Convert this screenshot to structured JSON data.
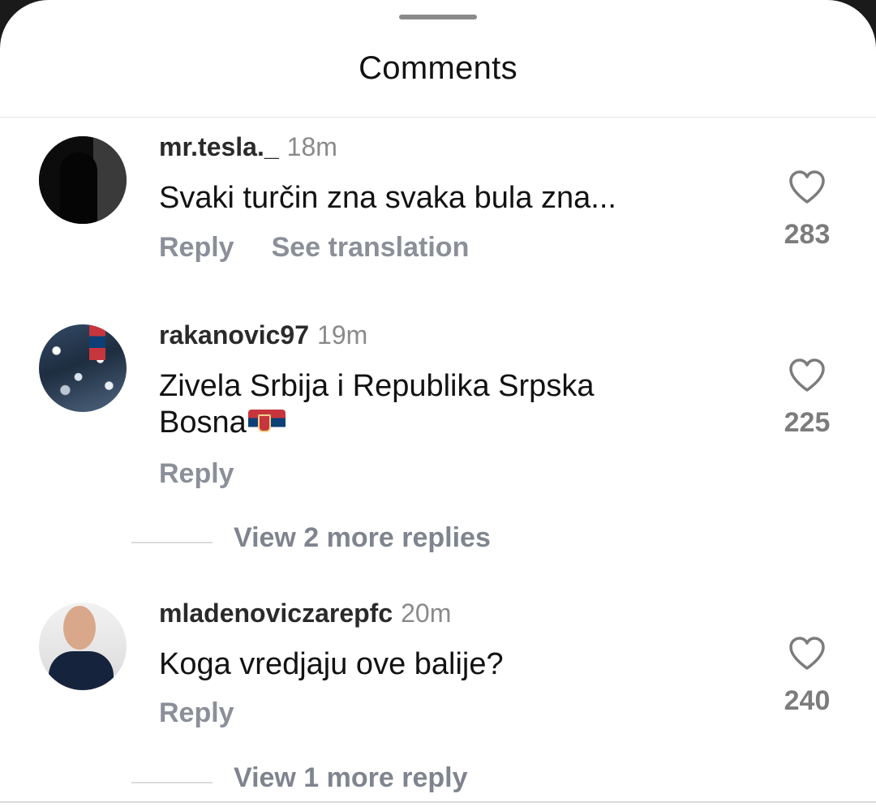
{
  "sheet": {
    "title": "Comments"
  },
  "comments": [
    {
      "username": "mr.tesla._",
      "time": "18m",
      "text": "Svaki turčin zna svaka bula zna...",
      "reply_label": "Reply",
      "translate_label": "See translation",
      "likes": "283",
      "avatar_icon": "avatar-photo"
    },
    {
      "username": "rakanovic97",
      "time": "19m",
      "text_line1": "Zivela Srbija i Republika Srpska",
      "text_line2": "Bosna",
      "reply_label": "Reply",
      "likes": "225",
      "view_more": "View 2 more replies",
      "avatar_icon": "avatar-photo"
    },
    {
      "username": "mladenoviczarepfc",
      "time": "20m",
      "text": "Koga vredjaju ove balije?",
      "reply_label": "Reply",
      "likes": "240",
      "view_more": "View 1 more reply",
      "avatar_icon": "avatar-photo"
    }
  ],
  "icons": {
    "like": "heart-outline-icon",
    "flag": "serbia-flag-emoji"
  },
  "colors": {
    "background": "#ffffff",
    "text": "#121212",
    "secondary": "#8a8f98"
  }
}
